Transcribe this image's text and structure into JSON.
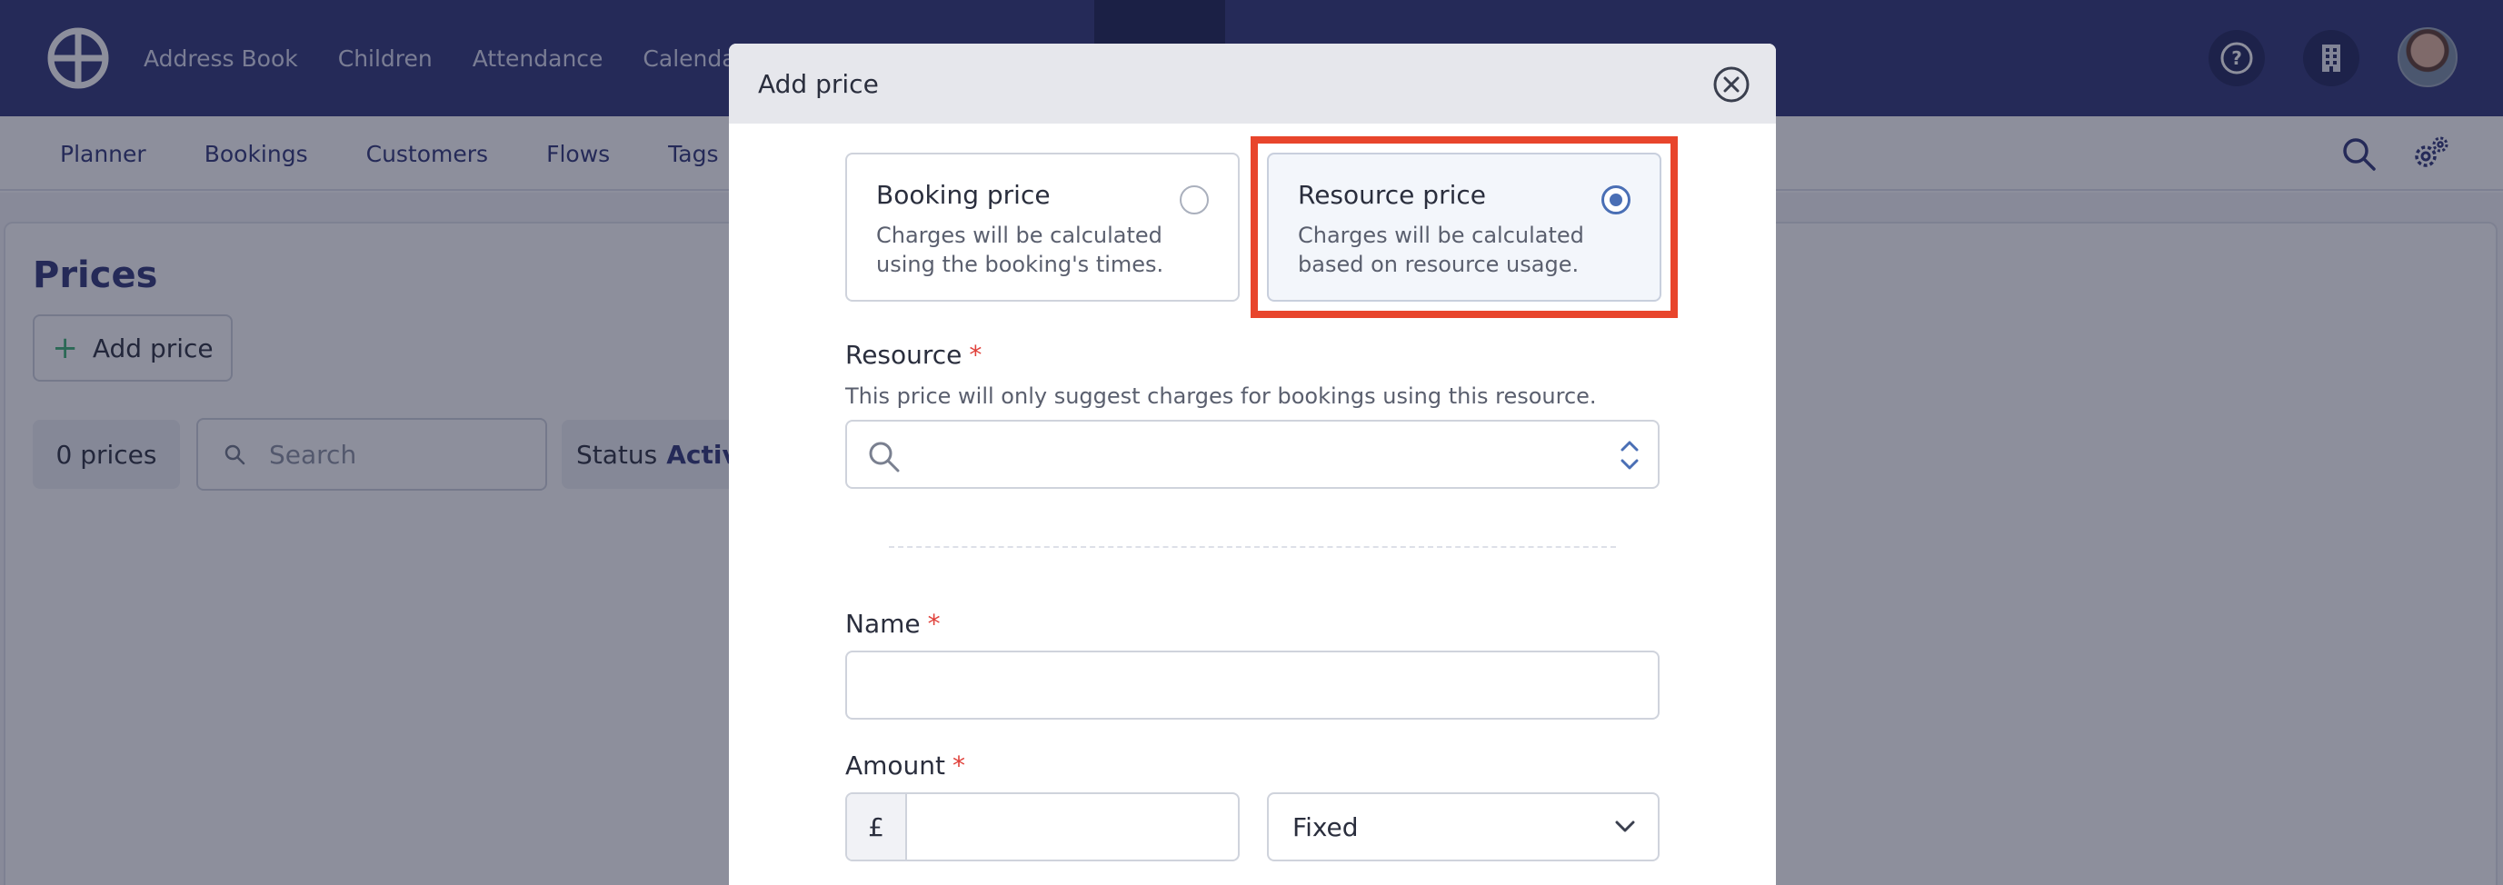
{
  "topnav": {
    "items": [
      "Address Book",
      "Children",
      "Attendance",
      "Calendar"
    ]
  },
  "subnav": {
    "items": [
      "Planner",
      "Bookings",
      "Customers",
      "Flows",
      "Tags"
    ]
  },
  "page": {
    "title": "Prices",
    "add_button_label": "Add price",
    "count_label": "0 prices",
    "search_placeholder": "Search",
    "status_label": "Status",
    "status_value": "Active"
  },
  "modal": {
    "title": "Add price",
    "options": [
      {
        "title": "Booking price",
        "description": "Charges will be calculated using the booking's times.",
        "selected": false
      },
      {
        "title": "Resource price",
        "description": "Charges will be calculated based on resource usage.",
        "selected": true
      }
    ],
    "resource": {
      "label": "Resource",
      "required_mark": "*",
      "hint": "This price will only suggest charges for bookings using this resource.",
      "value": ""
    },
    "name": {
      "label": "Name",
      "required_mark": "*",
      "value": ""
    },
    "amount": {
      "label": "Amount",
      "required_mark": "*",
      "currency_symbol": "£",
      "value": "",
      "type_selected": "Fixed"
    }
  },
  "colors": {
    "nav_bg": "#2e3576",
    "highlight": "#e8452c",
    "radio_selected": "#4a6fb5",
    "required": "#e0403a",
    "add_icon": "#3bb273"
  },
  "icons": [
    "app-logo-icon",
    "help-icon",
    "building-icon",
    "user-avatar",
    "search-icon",
    "settings-cogs-icon",
    "plus-icon",
    "close-icon",
    "chevron-up-down-icon",
    "chevron-down-icon"
  ]
}
